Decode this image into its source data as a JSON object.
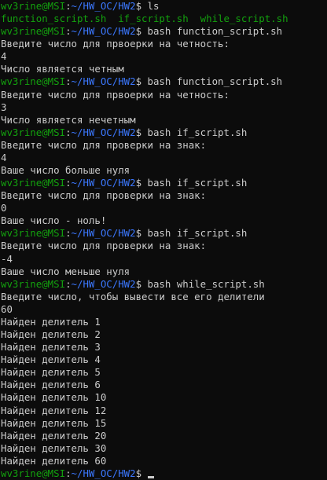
{
  "prompt": {
    "user_host": "wv3rine@MSI",
    "sep": ":",
    "path": "~/HW_OC/HW2",
    "symbol": "$ "
  },
  "colors": {
    "background": "#0c0c0c",
    "text": "#cccccc",
    "user_host": "#13a10e",
    "path": "#3b78ff"
  },
  "lines": [
    {
      "type": "prompt",
      "command": "ls"
    },
    {
      "type": "ls",
      "files": [
        "function_script.sh",
        "if_script.sh",
        "while_script.sh"
      ]
    },
    {
      "type": "prompt",
      "command": "bash function_script.sh"
    },
    {
      "type": "out",
      "text": "Введите число для првоерки на четность:"
    },
    {
      "type": "out",
      "text": "4"
    },
    {
      "type": "out",
      "text": "Число является четным"
    },
    {
      "type": "prompt",
      "command": "bash function_script.sh"
    },
    {
      "type": "out",
      "text": "Введите число для првоерки на четность:"
    },
    {
      "type": "out",
      "text": "3"
    },
    {
      "type": "out",
      "text": "Число является нечетным"
    },
    {
      "type": "prompt",
      "command": "bash if_script.sh"
    },
    {
      "type": "out",
      "text": "Введите число для проверки на знак:"
    },
    {
      "type": "out",
      "text": "4"
    },
    {
      "type": "out",
      "text": "Ваше число больше нуля"
    },
    {
      "type": "prompt",
      "command": "bash if_script.sh"
    },
    {
      "type": "out",
      "text": "Введите число для проверки на знак:"
    },
    {
      "type": "out",
      "text": "0"
    },
    {
      "type": "out",
      "text": "Ваше число - ноль!"
    },
    {
      "type": "prompt",
      "command": "bash if_script.sh"
    },
    {
      "type": "out",
      "text": "Введите число для проверки на знак:"
    },
    {
      "type": "out",
      "text": "-4"
    },
    {
      "type": "out",
      "text": "Ваше число меньше нуля"
    },
    {
      "type": "prompt",
      "command": "bash while_script.sh"
    },
    {
      "type": "out",
      "text": "Введите число, чтобы вывести все его делители"
    },
    {
      "type": "out",
      "text": "60"
    },
    {
      "type": "out",
      "text": "Найден делитель 1"
    },
    {
      "type": "out",
      "text": "Найден делитель 2"
    },
    {
      "type": "out",
      "text": "Найден делитель 3"
    },
    {
      "type": "out",
      "text": "Найден делитель 4"
    },
    {
      "type": "out",
      "text": "Найден делитель 5"
    },
    {
      "type": "out",
      "text": "Найден делитель 6"
    },
    {
      "type": "out",
      "text": "Найден делитель 10"
    },
    {
      "type": "out",
      "text": "Найден делитель 12"
    },
    {
      "type": "out",
      "text": "Найден делитель 15"
    },
    {
      "type": "out",
      "text": "Найден делитель 20"
    },
    {
      "type": "out",
      "text": "Найден делитель 30"
    },
    {
      "type": "out",
      "text": "Найден делитель 60"
    },
    {
      "type": "prompt",
      "command": "",
      "cursor": true
    }
  ]
}
